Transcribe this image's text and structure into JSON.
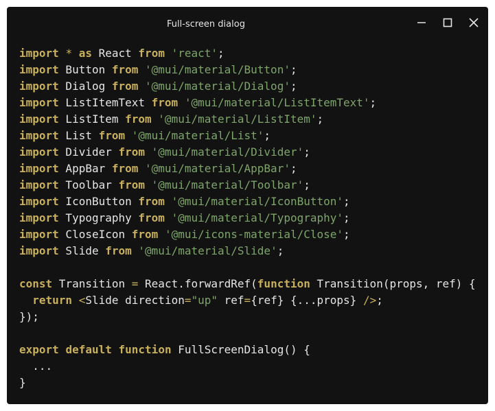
{
  "window": {
    "title": "Full-screen dialog",
    "controls": {
      "minimize_icon": "minimize-icon",
      "maximize_icon": "maximize-icon",
      "close_icon": "close-icon"
    }
  },
  "colors": {
    "background": "#121212",
    "keyword": "#c8b05c",
    "string": "#7ea66a",
    "text": "#e6e6e6"
  },
  "code_lines": [
    [
      {
        "t": "import",
        "c": "kw"
      },
      {
        "t": " ",
        "c": "id"
      },
      {
        "t": "*",
        "c": "op"
      },
      {
        "t": " ",
        "c": "id"
      },
      {
        "t": "as",
        "c": "kw"
      },
      {
        "t": " React ",
        "c": "id"
      },
      {
        "t": "from",
        "c": "kw"
      },
      {
        "t": " ",
        "c": "id"
      },
      {
        "t": "'react'",
        "c": "str"
      },
      {
        "t": ";",
        "c": "id"
      }
    ],
    [
      {
        "t": "import",
        "c": "kw"
      },
      {
        "t": " Button ",
        "c": "id"
      },
      {
        "t": "from",
        "c": "kw"
      },
      {
        "t": " ",
        "c": "id"
      },
      {
        "t": "'@mui/material/Button'",
        "c": "str"
      },
      {
        "t": ";",
        "c": "id"
      }
    ],
    [
      {
        "t": "import",
        "c": "kw"
      },
      {
        "t": " Dialog ",
        "c": "id"
      },
      {
        "t": "from",
        "c": "kw"
      },
      {
        "t": " ",
        "c": "id"
      },
      {
        "t": "'@mui/material/Dialog'",
        "c": "str"
      },
      {
        "t": ";",
        "c": "id"
      }
    ],
    [
      {
        "t": "import",
        "c": "kw"
      },
      {
        "t": " ListItemText ",
        "c": "id"
      },
      {
        "t": "from",
        "c": "kw"
      },
      {
        "t": " ",
        "c": "id"
      },
      {
        "t": "'@mui/material/ListItemText'",
        "c": "str"
      },
      {
        "t": ";",
        "c": "id"
      }
    ],
    [
      {
        "t": "import",
        "c": "kw"
      },
      {
        "t": " ListItem ",
        "c": "id"
      },
      {
        "t": "from",
        "c": "kw"
      },
      {
        "t": " ",
        "c": "id"
      },
      {
        "t": "'@mui/material/ListItem'",
        "c": "str"
      },
      {
        "t": ";",
        "c": "id"
      }
    ],
    [
      {
        "t": "import",
        "c": "kw"
      },
      {
        "t": " List ",
        "c": "id"
      },
      {
        "t": "from",
        "c": "kw"
      },
      {
        "t": " ",
        "c": "id"
      },
      {
        "t": "'@mui/material/List'",
        "c": "str"
      },
      {
        "t": ";",
        "c": "id"
      }
    ],
    [
      {
        "t": "import",
        "c": "kw"
      },
      {
        "t": " Divider ",
        "c": "id"
      },
      {
        "t": "from",
        "c": "kw"
      },
      {
        "t": " ",
        "c": "id"
      },
      {
        "t": "'@mui/material/Divider'",
        "c": "str"
      },
      {
        "t": ";",
        "c": "id"
      }
    ],
    [
      {
        "t": "import",
        "c": "kw"
      },
      {
        "t": " AppBar ",
        "c": "id"
      },
      {
        "t": "from",
        "c": "kw"
      },
      {
        "t": " ",
        "c": "id"
      },
      {
        "t": "'@mui/material/AppBar'",
        "c": "str"
      },
      {
        "t": ";",
        "c": "id"
      }
    ],
    [
      {
        "t": "import",
        "c": "kw"
      },
      {
        "t": " Toolbar ",
        "c": "id"
      },
      {
        "t": "from",
        "c": "kw"
      },
      {
        "t": " ",
        "c": "id"
      },
      {
        "t": "'@mui/material/Toolbar'",
        "c": "str"
      },
      {
        "t": ";",
        "c": "id"
      }
    ],
    [
      {
        "t": "import",
        "c": "kw"
      },
      {
        "t": " IconButton ",
        "c": "id"
      },
      {
        "t": "from",
        "c": "kw"
      },
      {
        "t": " ",
        "c": "id"
      },
      {
        "t": "'@mui/material/IconButton'",
        "c": "str"
      },
      {
        "t": ";",
        "c": "id"
      }
    ],
    [
      {
        "t": "import",
        "c": "kw"
      },
      {
        "t": " Typography ",
        "c": "id"
      },
      {
        "t": "from",
        "c": "kw"
      },
      {
        "t": " ",
        "c": "id"
      },
      {
        "t": "'@mui/material/Typography'",
        "c": "str"
      },
      {
        "t": ";",
        "c": "id"
      }
    ],
    [
      {
        "t": "import",
        "c": "kw"
      },
      {
        "t": " CloseIcon ",
        "c": "id"
      },
      {
        "t": "from",
        "c": "kw"
      },
      {
        "t": " ",
        "c": "id"
      },
      {
        "t": "'@mui/icons-material/Close'",
        "c": "str"
      },
      {
        "t": ";",
        "c": "id"
      }
    ],
    [
      {
        "t": "import",
        "c": "kw"
      },
      {
        "t": " Slide ",
        "c": "id"
      },
      {
        "t": "from",
        "c": "kw"
      },
      {
        "t": " ",
        "c": "id"
      },
      {
        "t": "'@mui/material/Slide'",
        "c": "str"
      },
      {
        "t": ";",
        "c": "id"
      }
    ],
    [],
    [
      {
        "t": "const",
        "c": "kw"
      },
      {
        "t": " Transition ",
        "c": "id"
      },
      {
        "t": "=",
        "c": "op"
      },
      {
        "t": " React.forwardRef(",
        "c": "id"
      },
      {
        "t": "function",
        "c": "kw"
      },
      {
        "t": " Transition(props, ref) {",
        "c": "id"
      }
    ],
    [
      {
        "t": "  ",
        "c": "id"
      },
      {
        "t": "return",
        "c": "kw"
      },
      {
        "t": " ",
        "c": "id"
      },
      {
        "t": "<",
        "c": "op"
      },
      {
        "t": "Slide direction",
        "c": "id"
      },
      {
        "t": "=",
        "c": "op"
      },
      {
        "t": "\"up\"",
        "c": "str"
      },
      {
        "t": " ref",
        "c": "id"
      },
      {
        "t": "=",
        "c": "op"
      },
      {
        "t": "{ref} {...props} ",
        "c": "id"
      },
      {
        "t": "/>",
        "c": "op"
      },
      {
        "t": ";",
        "c": "id"
      }
    ],
    [
      {
        "t": "});",
        "c": "id"
      }
    ],
    [],
    [
      {
        "t": "export",
        "c": "kw"
      },
      {
        "t": " ",
        "c": "id"
      },
      {
        "t": "default",
        "c": "kw"
      },
      {
        "t": " ",
        "c": "id"
      },
      {
        "t": "function",
        "c": "kw"
      },
      {
        "t": " FullScreenDialog() {",
        "c": "id"
      }
    ],
    [
      {
        "t": "  ...",
        "c": "id"
      }
    ],
    [
      {
        "t": "}",
        "c": "id"
      }
    ]
  ]
}
